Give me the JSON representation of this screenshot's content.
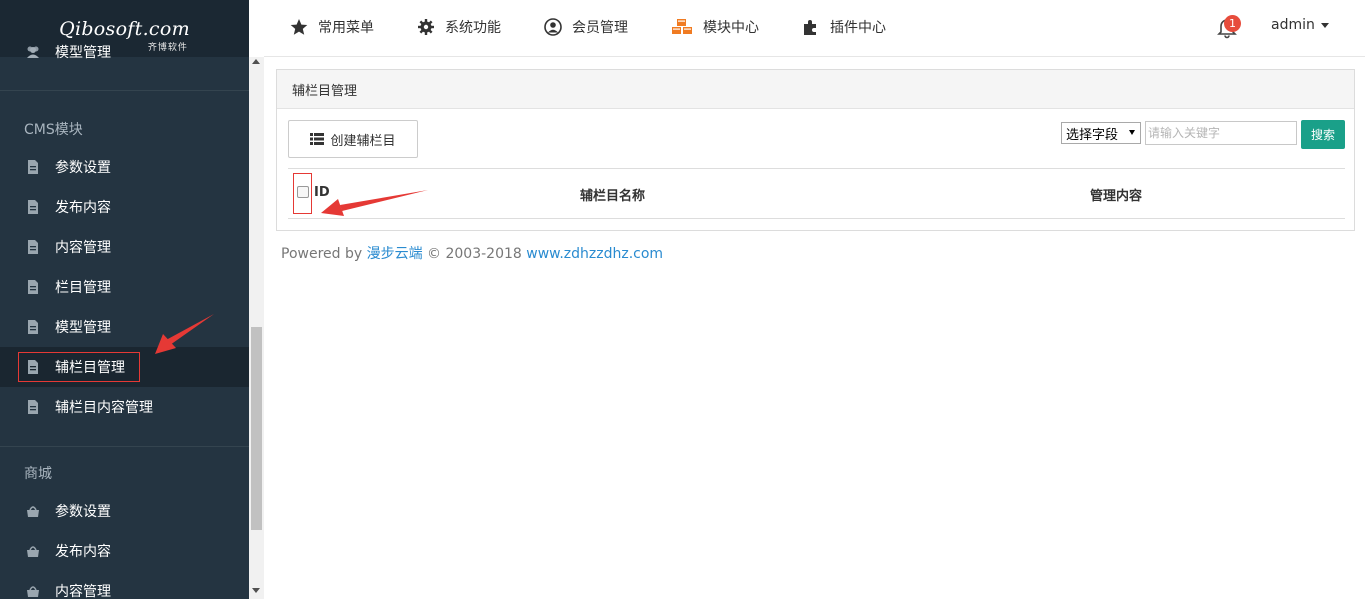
{
  "logo": {
    "text": "Qibosoft",
    "suffix": ".com",
    "sub": "齐博软件"
  },
  "sidebar": {
    "top_item": {
      "label": "模型管理",
      "icon": "users-icon"
    },
    "groups": [
      {
        "title": "CMS模块",
        "items": [
          {
            "label": "参数设置",
            "icon": "file-icon"
          },
          {
            "label": "发布内容",
            "icon": "file-icon"
          },
          {
            "label": "内容管理",
            "icon": "file-icon"
          },
          {
            "label": "栏目管理",
            "icon": "file-icon"
          },
          {
            "label": "模型管理",
            "icon": "file-icon"
          },
          {
            "label": "辅栏目管理",
            "icon": "file-icon",
            "active": true
          },
          {
            "label": "辅栏目内容管理",
            "icon": "file-icon"
          }
        ]
      },
      {
        "title": "商城",
        "items": [
          {
            "label": "参数设置",
            "icon": "shopping-bag-icon"
          },
          {
            "label": "发布内容",
            "icon": "shopping-bag-icon"
          },
          {
            "label": "内容管理",
            "icon": "shopping-bag-icon"
          }
        ]
      }
    ]
  },
  "topnav": {
    "items": [
      {
        "label": "常用菜单",
        "icon": "star-icon"
      },
      {
        "label": "系统功能",
        "icon": "gear-icon"
      },
      {
        "label": "会员管理",
        "icon": "user-circle-icon"
      },
      {
        "label": "模块中心",
        "icon": "cubes-icon"
      },
      {
        "label": "插件中心",
        "icon": "puzzle-icon"
      }
    ],
    "notification_count": "1",
    "user": "admin"
  },
  "panel": {
    "title": "辅栏目管理",
    "create_label": "创建辅栏目",
    "select_label": "选择字段",
    "search_placeholder": "请输入关键字",
    "search_label": "搜索",
    "columns": [
      "ID",
      "辅栏目名称",
      "管理内容"
    ]
  },
  "footer": {
    "prefix": "Powered by ",
    "brand": "漫步云端",
    "copyright": " © 2003-2018  ",
    "site": "www.zdhzzdhz.com"
  },
  "colors": {
    "sidebar": "#243441",
    "accent": "#1aa089",
    "badge": "#e74c3c",
    "annotation": "#e53935"
  }
}
